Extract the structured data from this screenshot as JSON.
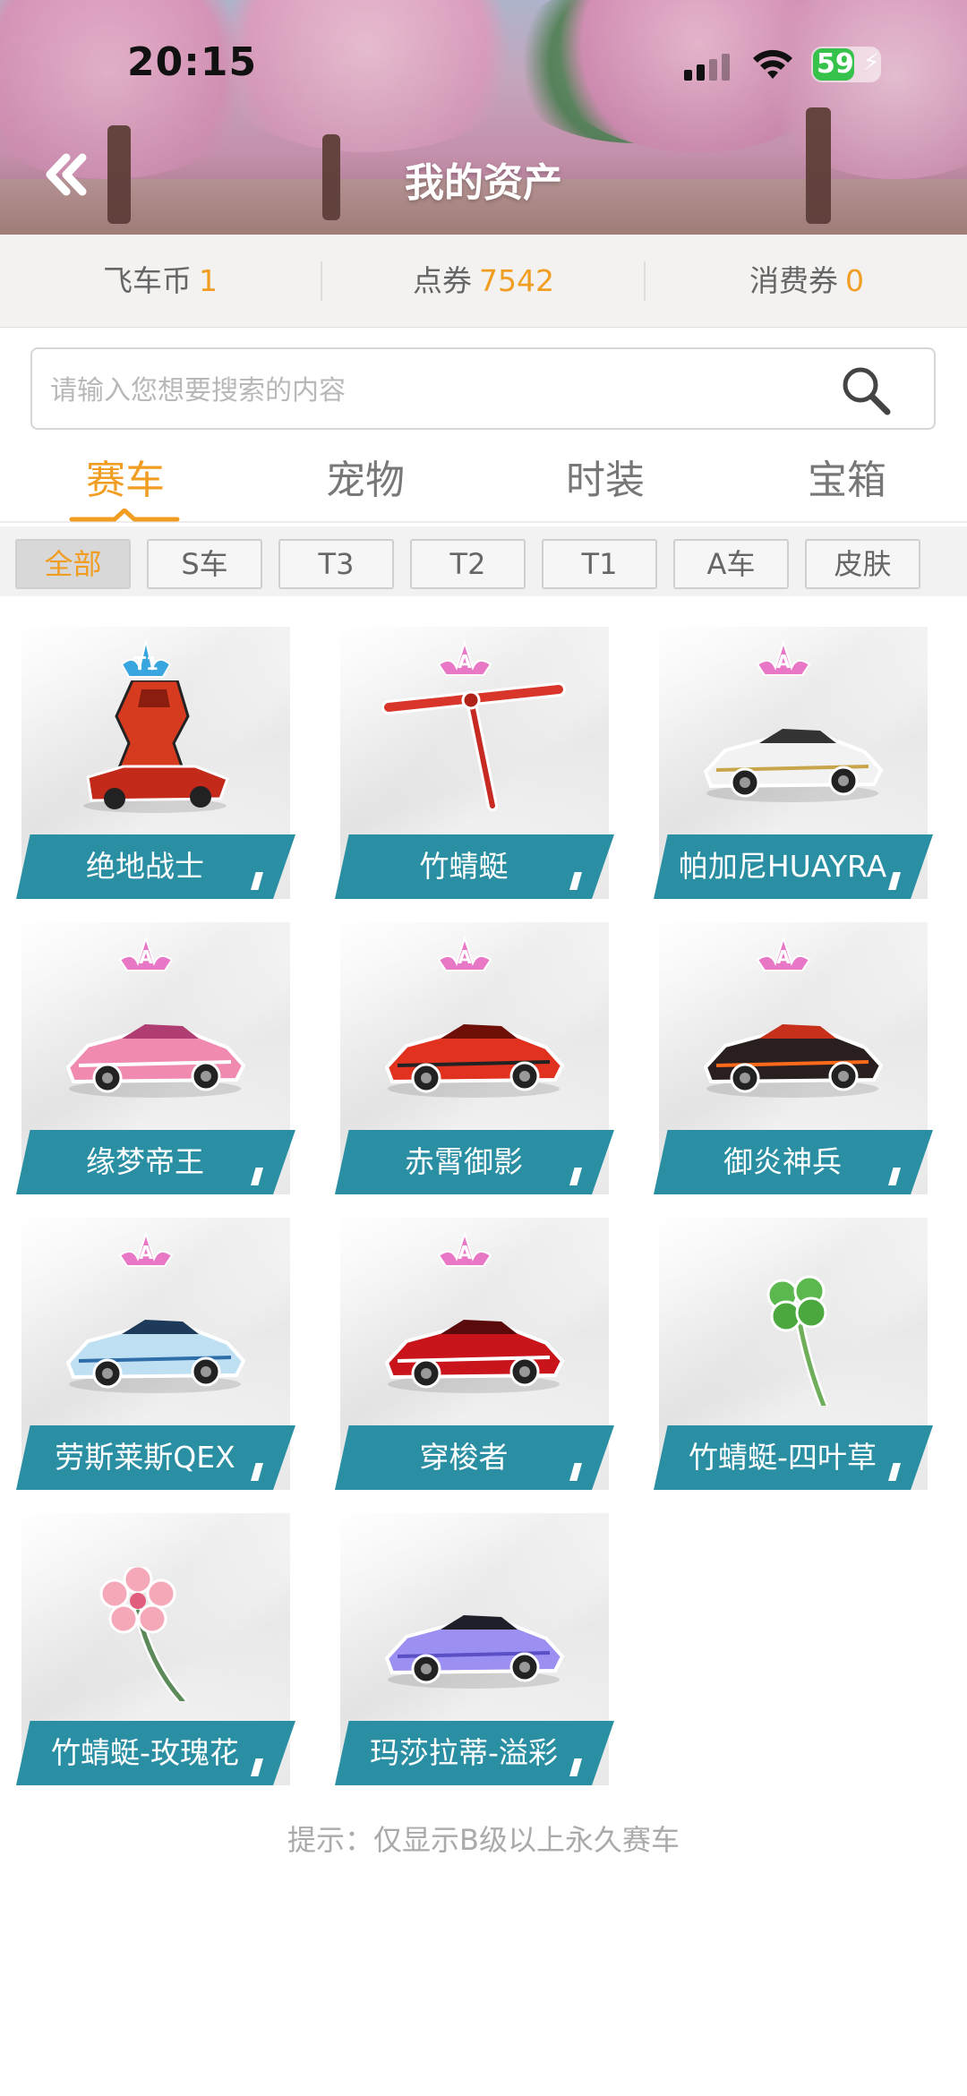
{
  "status_bar": {
    "time": "20:15",
    "battery": "59"
  },
  "header": {
    "title": "我的资产"
  },
  "currencies": [
    {
      "label": "飞车币",
      "value": "1"
    },
    {
      "label": "点券",
      "value": "7542"
    },
    {
      "label": "消费券",
      "value": "0"
    }
  ],
  "search": {
    "placeholder": "请输入您想要搜索的内容"
  },
  "tabs": [
    {
      "label": "赛车",
      "active": true
    },
    {
      "label": "宠物",
      "active": false
    },
    {
      "label": "时装",
      "active": false
    },
    {
      "label": "宝箱",
      "active": false
    }
  ],
  "filters": [
    {
      "label": "全部",
      "active": true
    },
    {
      "label": "S车",
      "active": false
    },
    {
      "label": "T3",
      "active": false
    },
    {
      "label": "T2",
      "active": false
    },
    {
      "label": "T1",
      "active": false
    },
    {
      "label": "A车",
      "active": false
    },
    {
      "label": "皮肤",
      "active": false
    }
  ],
  "items": [
    {
      "name": "绝地战士",
      "grade": "T1",
      "art": "red-mech-car"
    },
    {
      "name": "竹蜻蜓",
      "grade": "A",
      "art": "bamboo-dragonfly"
    },
    {
      "name": "帕加尼HUAYRA",
      "grade": "A",
      "art": "white-supercar"
    },
    {
      "name": "缘梦帝王",
      "grade": "A",
      "art": "pink-racer"
    },
    {
      "name": "赤霄御影",
      "grade": "A",
      "art": "red-racer"
    },
    {
      "name": "御炎神兵",
      "grade": "A",
      "art": "flame-racer"
    },
    {
      "name": "劳斯莱斯QEX",
      "grade": "A",
      "art": "blue-concept-car"
    },
    {
      "name": "穿梭者",
      "grade": "A",
      "art": "red-roadster"
    },
    {
      "name": "竹蜻蜓-四叶草",
      "grade": "",
      "art": "clover-dragonfly"
    },
    {
      "name": "竹蜻蜓-玫瑰花",
      "grade": "",
      "art": "flower-dragonfly"
    },
    {
      "name": "玛莎拉蒂-溢彩",
      "grade": "",
      "art": "purple-supercar"
    }
  ],
  "hint": "提示：仅显示B级以上永久赛车",
  "colors": {
    "accent": "#f09d22",
    "label_bar": "#2a8fa3",
    "grade_a": "#e878c6",
    "grade_t1": "#3aa6e0"
  }
}
